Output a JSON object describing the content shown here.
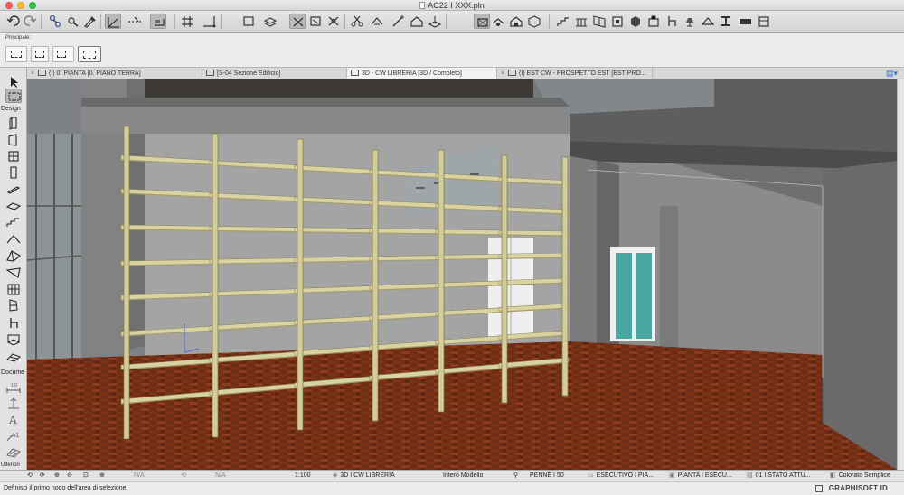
{
  "window": {
    "title": "AC22 I XXX.pln"
  },
  "infobox": {
    "label": "Principale:"
  },
  "tabs": [
    {
      "label": "(I) 0. PIANTA [0. PIANO TERRA]"
    },
    {
      "label": "[S-04 Sezione Edificio]"
    },
    {
      "label": "3D - CW LIBRERIA [3D / Completo]"
    },
    {
      "label": "(I) EST CW - PROSPETTO EST [EST PRO..."
    }
  ],
  "toolbox": {
    "design_label": "Design",
    "document_label": "Docume",
    "more_label": "Ulteriori"
  },
  "statusbar": {
    "zoom_na_1": "N/A",
    "zoom_na_2": "N/A",
    "scale": "1:100",
    "view": "3D I CW LIBRERIA",
    "model": "Intero Modello",
    "pens": "PENNE I 50",
    "exec": "ESECUTIVO I PIA...",
    "plan": "PIANTA I ESECU...",
    "state": "01 I STATO ATTU...",
    "style": "Colorato Semplice"
  },
  "hint": {
    "text": "Definisci il primo nodo dell'area di selezione."
  },
  "brand": {
    "text": "GRAPHISOFT ID"
  }
}
